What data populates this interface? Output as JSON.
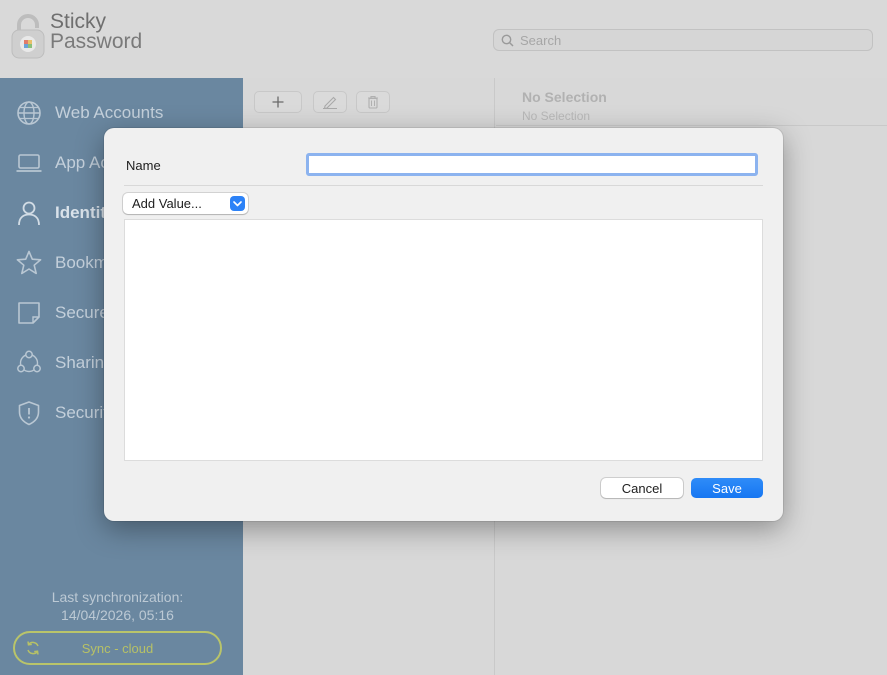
{
  "app": {
    "logo_line1": "Sticky",
    "logo_line2": "Password"
  },
  "search": {
    "placeholder": "Search"
  },
  "sidebar": {
    "items": [
      {
        "label": "Web Accounts",
        "icon": "globe-icon"
      },
      {
        "label": "App Ac",
        "icon": "laptop-icon"
      },
      {
        "label": "Identit",
        "icon": "person-icon",
        "active": true
      },
      {
        "label": "Bookm",
        "icon": "star-icon"
      },
      {
        "label": "Secure",
        "icon": "note-icon"
      },
      {
        "label": "Sharing",
        "icon": "sharing-icon"
      },
      {
        "label": "Securit",
        "icon": "shield-icon"
      }
    ],
    "sync_label": "Last synchronization:",
    "sync_time": "14/04/2026, 05:16",
    "sync_button": "Sync - cloud"
  },
  "detail": {
    "title": "No Selection",
    "subtitle": "No Selection"
  },
  "dialog": {
    "name_label": "Name",
    "name_value": "",
    "add_value_label": "Add Value...",
    "cancel_label": "Cancel",
    "save_label": "Save"
  },
  "colors": {
    "sidebar": "#6a87a0",
    "accent": "#2c82f7",
    "sync": "#b9c46a"
  }
}
